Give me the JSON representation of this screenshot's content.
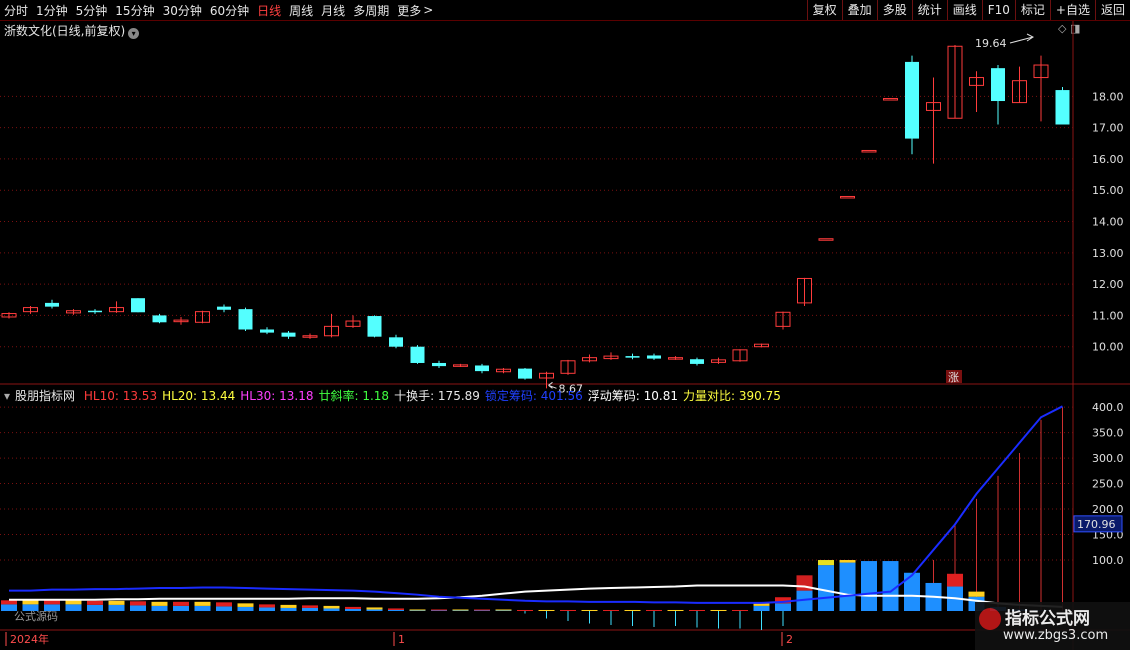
{
  "toolbar": {
    "periods": [
      "分时",
      "1分钟",
      "5分钟",
      "15分钟",
      "30分钟",
      "60分钟",
      "日线",
      "周线",
      "月线",
      "多周期",
      "更多"
    ],
    "active_period": "日线",
    "more_arrow": ">",
    "buttons": [
      "复权",
      "叠加",
      "多股",
      "统计",
      "画线",
      "F10",
      "标记",
      "+自选",
      "返回"
    ]
  },
  "main": {
    "title": "浙数文化(日线,前复权)",
    "high_label": "19.64",
    "low_label": "8.67",
    "zhang_badge": "涨",
    "price_ticks": [
      "18.00",
      "17.00",
      "16.00",
      "15.00",
      "14.00",
      "13.00",
      "12.00",
      "11.00",
      "10.00"
    ]
  },
  "indicator": {
    "name": "股朋指标网",
    "values": [
      {
        "label": "HL10: ",
        "value": "13.53",
        "color": "#ff3b3b"
      },
      {
        "label": "HL20: ",
        "value": "13.44",
        "color": "#ffff40"
      },
      {
        "label": "HL30: ",
        "value": "13.18",
        "color": "#ff40ff"
      },
      {
        "label": "廿斜率: ",
        "value": "1.18",
        "color": "#40ff40"
      },
      {
        "label": "十换手: ",
        "value": "175.89",
        "color": "#e8e8e8"
      },
      {
        "label": "锁定筹码: ",
        "value": "401.56",
        "color": "#2040ff"
      },
      {
        "label": "浮动筹码: ",
        "value": "10.81",
        "color": "#ffffff"
      },
      {
        "label": "力量对比: ",
        "value": "390.75",
        "color": "#ffff40"
      }
    ],
    "ticks": [
      "400.0",
      "350.0",
      "300.0",
      "250.0",
      "200.0",
      "150.0",
      "100.0"
    ],
    "current_value": "170.96",
    "formula_label": "公式源码"
  },
  "dates": {
    "year": "2024年",
    "m1": "1",
    "m2": "2"
  },
  "watermark": {
    "title": "指标公式网",
    "url": "www.zbgs3.com"
  },
  "colors": {
    "up": "#ff3c3c",
    "down": "#54ffff",
    "grid": "#7a1010",
    "white_line": "#ffffff",
    "blue_line": "#1a2cff"
  },
  "chart_data": [
    {
      "type": "candlestick",
      "ylim": [
        9.0,
        19.8
      ],
      "candles": [
        [
          10.95,
          11.06,
          11.1,
          10.9
        ],
        [
          11.12,
          11.25,
          11.3,
          11.05
        ],
        [
          11.4,
          11.28,
          11.5,
          11.22
        ],
        [
          11.08,
          11.15,
          11.2,
          11.02
        ],
        [
          11.15,
          11.12,
          11.2,
          11.05
        ],
        [
          11.12,
          11.25,
          11.45,
          11.08
        ],
        [
          11.55,
          11.1,
          11.55,
          11.1
        ],
        [
          11.0,
          10.78,
          11.05,
          10.75
        ],
        [
          10.8,
          10.85,
          10.95,
          10.7
        ],
        [
          10.78,
          11.12,
          11.15,
          10.75
        ],
        [
          11.28,
          11.18,
          11.35,
          11.1
        ],
        [
          11.2,
          10.55,
          11.25,
          10.5
        ],
        [
          10.55,
          10.45,
          10.62,
          10.4
        ],
        [
          10.45,
          10.32,
          10.5,
          10.25
        ],
        [
          10.32,
          10.35,
          10.42,
          10.25
        ],
        [
          10.35,
          10.65,
          11.05,
          10.3
        ],
        [
          10.65,
          10.82,
          11.0,
          10.6
        ],
        [
          10.98,
          10.32,
          11.0,
          10.3
        ],
        [
          10.3,
          10.0,
          10.38,
          9.95
        ],
        [
          10.0,
          9.48,
          10.05,
          9.45
        ],
        [
          9.48,
          9.38,
          9.55,
          9.32
        ],
        [
          9.38,
          9.42,
          9.45,
          9.35
        ],
        [
          9.4,
          9.22,
          9.45,
          9.15
        ],
        [
          9.2,
          9.28,
          9.32,
          9.15
        ],
        [
          9.3,
          8.98,
          9.32,
          8.95
        ],
        [
          9.0,
          9.15,
          9.2,
          8.67
        ],
        [
          9.15,
          9.55,
          9.58,
          9.1
        ],
        [
          9.55,
          9.65,
          9.75,
          9.5
        ],
        [
          9.62,
          9.7,
          9.82,
          9.58
        ],
        [
          9.7,
          9.65,
          9.78,
          9.6
        ],
        [
          9.72,
          9.62,
          9.78,
          9.58
        ],
        [
          9.62,
          9.65,
          9.7,
          9.58
        ],
        [
          9.6,
          9.45,
          9.65,
          9.4
        ],
        [
          9.5,
          9.58,
          9.65,
          9.45
        ],
        [
          9.55,
          9.9,
          9.92,
          9.52
        ],
        [
          10.0,
          10.08,
          10.1,
          9.98
        ],
        [
          10.65,
          11.1,
          11.12,
          10.55
        ],
        [
          11.4,
          12.18,
          12.2,
          11.3
        ],
        [
          13.45,
          13.45,
          13.45,
          13.45
        ],
        [
          14.8,
          14.8,
          14.8,
          14.8
        ],
        [
          16.27,
          16.27,
          16.27,
          16.27
        ],
        [
          17.93,
          17.93,
          17.93,
          17.93
        ],
        [
          19.1,
          16.65,
          19.3,
          16.15
        ],
        [
          17.55,
          17.8,
          18.6,
          15.85
        ],
        [
          17.3,
          19.6,
          19.64,
          17.3
        ],
        [
          18.35,
          18.6,
          18.8,
          17.5
        ],
        [
          18.9,
          17.85,
          19.0,
          17.1
        ],
        [
          17.8,
          18.5,
          18.95,
          17.8
        ],
        [
          18.6,
          19.0,
          19.3,
          17.2
        ],
        [
          18.2,
          17.1,
          18.3,
          17.1
        ]
      ]
    },
    {
      "type": "bar-line",
      "ylim": [
        0,
        410
      ],
      "stack_bars": [
        [
          13,
          8
        ],
        [
          13,
          8
        ],
        [
          13,
          8
        ],
        [
          13,
          8
        ],
        [
          12,
          8
        ],
        [
          12,
          8
        ],
        [
          11,
          8
        ],
        [
          10,
          8
        ],
        [
          10,
          8
        ],
        [
          10,
          8
        ],
        [
          9,
          8
        ],
        [
          8,
          7
        ],
        [
          7,
          6
        ],
        [
          6,
          6
        ],
        [
          6,
          5
        ],
        [
          5,
          5
        ],
        [
          4,
          4
        ],
        [
          3,
          4
        ],
        [
          2,
          3
        ],
        [
          1,
          2
        ],
        [
          1,
          2
        ],
        [
          1,
          2
        ],
        [
          1,
          2
        ],
        [
          1,
          2
        ],
        [
          0,
          2
        ],
        [
          0,
          2
        ],
        [
          0,
          2
        ],
        [
          0,
          2
        ],
        [
          0,
          2
        ],
        [
          0,
          2
        ],
        [
          0,
          2
        ],
        [
          0,
          2
        ],
        [
          0,
          2
        ],
        [
          0,
          2
        ],
        [
          0,
          2
        ],
        [
          10,
          5
        ],
        [
          15,
          12
        ],
        [
          40,
          30
        ],
        [
          90,
          10
        ],
        [
          95,
          5
        ],
        [
          98,
          0
        ],
        [
          98,
          0
        ],
        [
          75,
          0
        ],
        [
          55,
          0
        ],
        [
          48,
          25
        ],
        [
          28,
          10
        ],
        [
          8,
          0
        ],
        [
          3,
          0
        ],
        [
          1,
          0
        ],
        [
          0,
          0
        ]
      ],
      "neg_spikes": [
        0,
        0,
        0,
        0,
        0,
        0,
        0,
        0,
        0,
        0,
        0,
        0,
        0,
        0,
        0,
        0,
        0,
        0,
        0,
        0,
        0,
        0,
        0,
        0,
        5,
        15,
        20,
        25,
        28,
        30,
        32,
        30,
        33,
        35,
        35,
        38,
        30,
        0,
        0,
        0,
        0,
        0,
        0,
        0,
        0,
        0,
        0,
        0,
        0,
        0
      ],
      "thin_up_lines": [
        0,
        0,
        0,
        0,
        0,
        0,
        0,
        0,
        0,
        0,
        0,
        0,
        0,
        0,
        0,
        0,
        0,
        0,
        0,
        0,
        0,
        0,
        0,
        0,
        0,
        0,
        0,
        0,
        0,
        0,
        0,
        0,
        0,
        0,
        0,
        0,
        0,
        0,
        0,
        0,
        0,
        0,
        0,
        100,
        170,
        220,
        265,
        310,
        375,
        400
      ],
      "white_line": [
        22,
        22,
        22,
        22,
        22,
        23,
        23,
        24,
        24,
        24,
        24,
        24,
        24,
        24,
        25,
        25,
        25,
        24,
        24,
        24,
        25,
        27,
        30,
        34,
        38,
        40,
        42,
        44,
        45,
        46,
        47,
        48,
        50,
        50,
        50,
        50,
        50,
        48,
        40,
        32,
        30,
        30,
        30,
        28,
        25,
        20,
        15,
        12,
        10,
        8
      ],
      "blue_line": [
        40,
        40,
        42,
        42,
        43,
        43,
        44,
        45,
        45,
        46,
        46,
        45,
        44,
        43,
        42,
        41,
        40,
        38,
        35,
        32,
        28,
        26,
        24,
        22,
        20,
        19,
        19,
        18,
        18,
        18,
        17,
        17,
        16,
        16,
        16,
        16,
        18,
        22,
        26,
        30,
        34,
        38,
        70,
        120,
        170,
        230,
        280,
        330,
        380,
        401.56
      ]
    }
  ]
}
